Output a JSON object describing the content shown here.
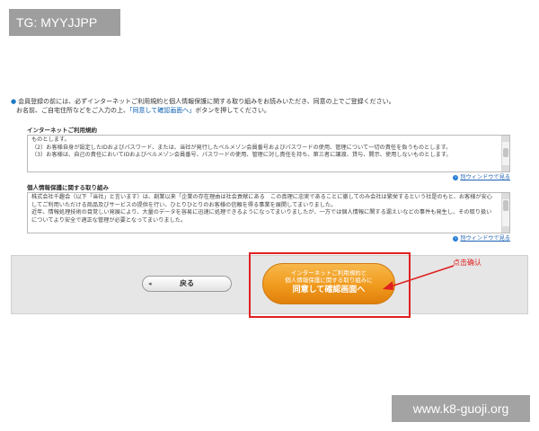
{
  "top_tag": "TG: MYYJJPP",
  "footer_tag": "www.k8-guoji.org",
  "intro": {
    "line1": "会員登録の前には、必ずインターネットご利用規約と個人情報保護に関する取り組みをお読みいただき、同意の上でご登録ください。",
    "line2_a": "お名前、ご自宅住所などをご入力の上、",
    "line2_link": "「同意して確認画面へ」",
    "line2_b": "ボタンを押してください。"
  },
  "terms": {
    "title": "インターネットご利用規約",
    "text": "ものとします。\n（2）お客様自身が設定したIDおよびパスワード、または、当社が発行したベルメゾン会員番号およびパスワードの使用、管理について一切の責任を負うものとします。\n（3）お客様は、自己の責任においてIDおよびベルメゾン会員番号、パスワードの使用、管理に対し責任を持ち、第三者に譲渡、貸与、開示、使用しないものとします。",
    "link": "別ウィンドウで見る"
  },
  "privacy": {
    "title": "個人情報保護に関する取り組み",
    "text": "株式会社千趣会（以下「当社」と言います）は、創業以来「企業の存在理由は社会貢献にある　この真理に忠実であることに徹してのみ会社は繁栄するという社是のもと、お客様が安心してご利用いただける商品及びサービスの提供を行い、ひとりひとりのお客様の信頼を得る事業を展開してまいりました。\n近年、情報処理技術の目覚しい発展により、大量のデータを容易に迅速に処理できるようになってまいりましたが、一方では個人情報に関する漏えいなどの事件も発生し、その取り扱いについてより安全で適正な管理が必要となってまいりました。",
    "link": "別ウィンドウで見る"
  },
  "back_button": "戻る",
  "confirm_button": {
    "line1": "インターネットご利用規約と",
    "line2": "個人情報保護に関する取り組みに",
    "line3": "同意して確認画面へ"
  },
  "annotation": "点击确认",
  "colors": {
    "accent_orange": "#f09a1d",
    "annotation_red": "#e02020",
    "link_blue": "#1d62b3"
  },
  "icons": {
    "back": "chevron-left-icon",
    "window": "new-window-icon"
  }
}
